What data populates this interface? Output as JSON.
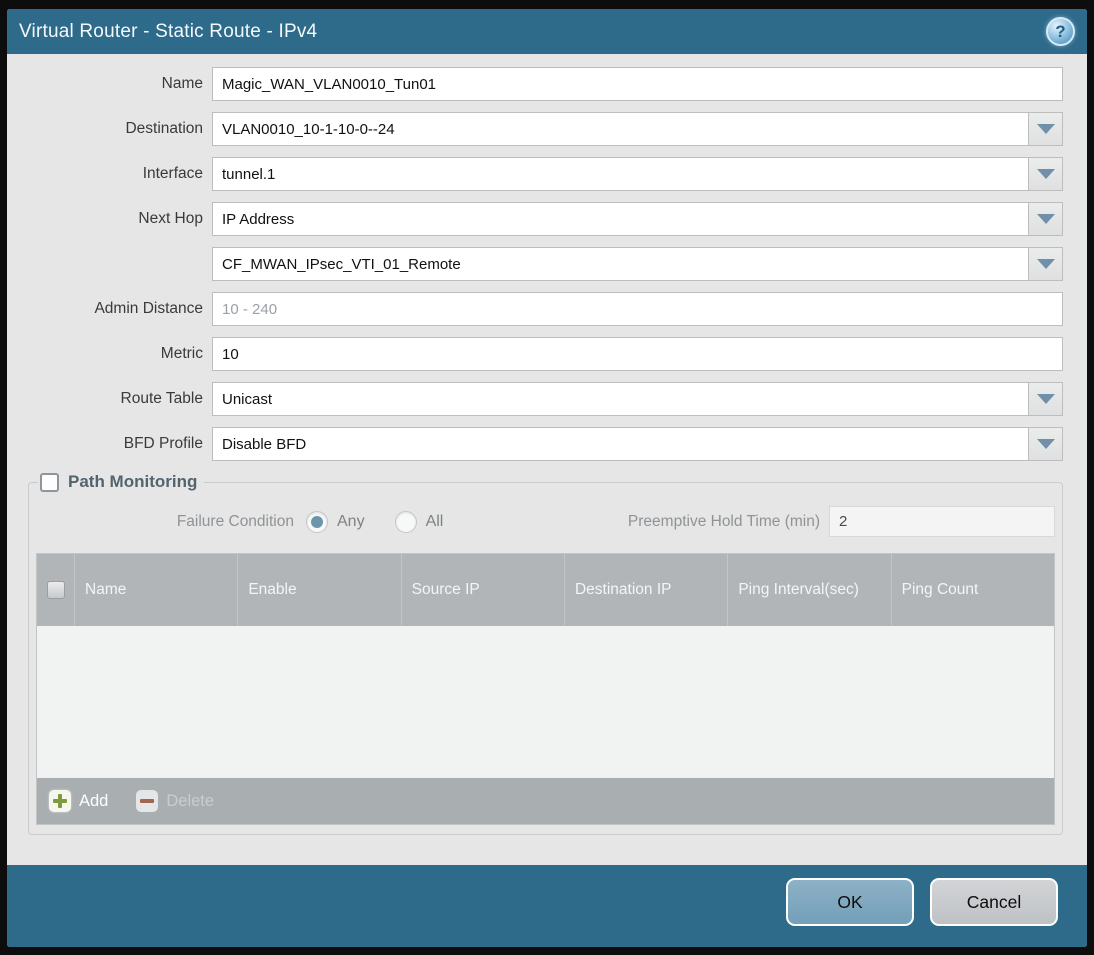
{
  "window": {
    "title": "Virtual Router - Static Route - IPv4",
    "help_icon_glyph": "?"
  },
  "form": {
    "name": {
      "label": "Name",
      "value": "Magic_WAN_VLAN0010_Tun01"
    },
    "destination": {
      "label": "Destination",
      "value": "VLAN0010_10-1-10-0--24"
    },
    "interface": {
      "label": "Interface",
      "value": "tunnel.1"
    },
    "next_hop": {
      "label": "Next Hop",
      "value": "IP Address"
    },
    "next_hop_address": {
      "value": "CF_MWAN_IPsec_VTI_01_Remote"
    },
    "admin_distance": {
      "label": "Admin Distance",
      "placeholder": "10 - 240"
    },
    "metric": {
      "label": "Metric",
      "value": "10"
    },
    "route_table": {
      "label": "Route Table",
      "value": "Unicast"
    },
    "bfd_profile": {
      "label": "BFD Profile",
      "value": "Disable BFD"
    }
  },
  "path_monitoring": {
    "title": "Path Monitoring",
    "enabled": false,
    "failure_condition": {
      "label": "Failure Condition",
      "options": [
        {
          "label": "Any",
          "selected": true
        },
        {
          "label": "All",
          "selected": false
        }
      ]
    },
    "preemptive_hold_time": {
      "label": "Preemptive Hold Time (min)",
      "value": "2",
      "disabled": true
    },
    "table": {
      "columns": [
        "Name",
        "Enable",
        "Source IP",
        "Destination IP",
        "Ping Interval(sec)",
        "Ping Count"
      ],
      "rows": []
    },
    "actions": {
      "add": "Add",
      "delete": "Delete",
      "delete_disabled": true
    }
  },
  "footer": {
    "ok": "OK",
    "cancel": "Cancel"
  },
  "colors": {
    "titlebar": "#2e6b8b",
    "body_background": "#e6e6e6",
    "table_header": "#b1b5b8",
    "table_footer_bar": "#a9aeb1",
    "ok_button": "#7ea9c1",
    "cancel_button": "#c7cacc",
    "add_icon_green": "#7d9b3e",
    "delete_icon_red": "#a2654d",
    "radio_selected": "#6c94ac",
    "caret_arrow": "#6f90a8"
  }
}
